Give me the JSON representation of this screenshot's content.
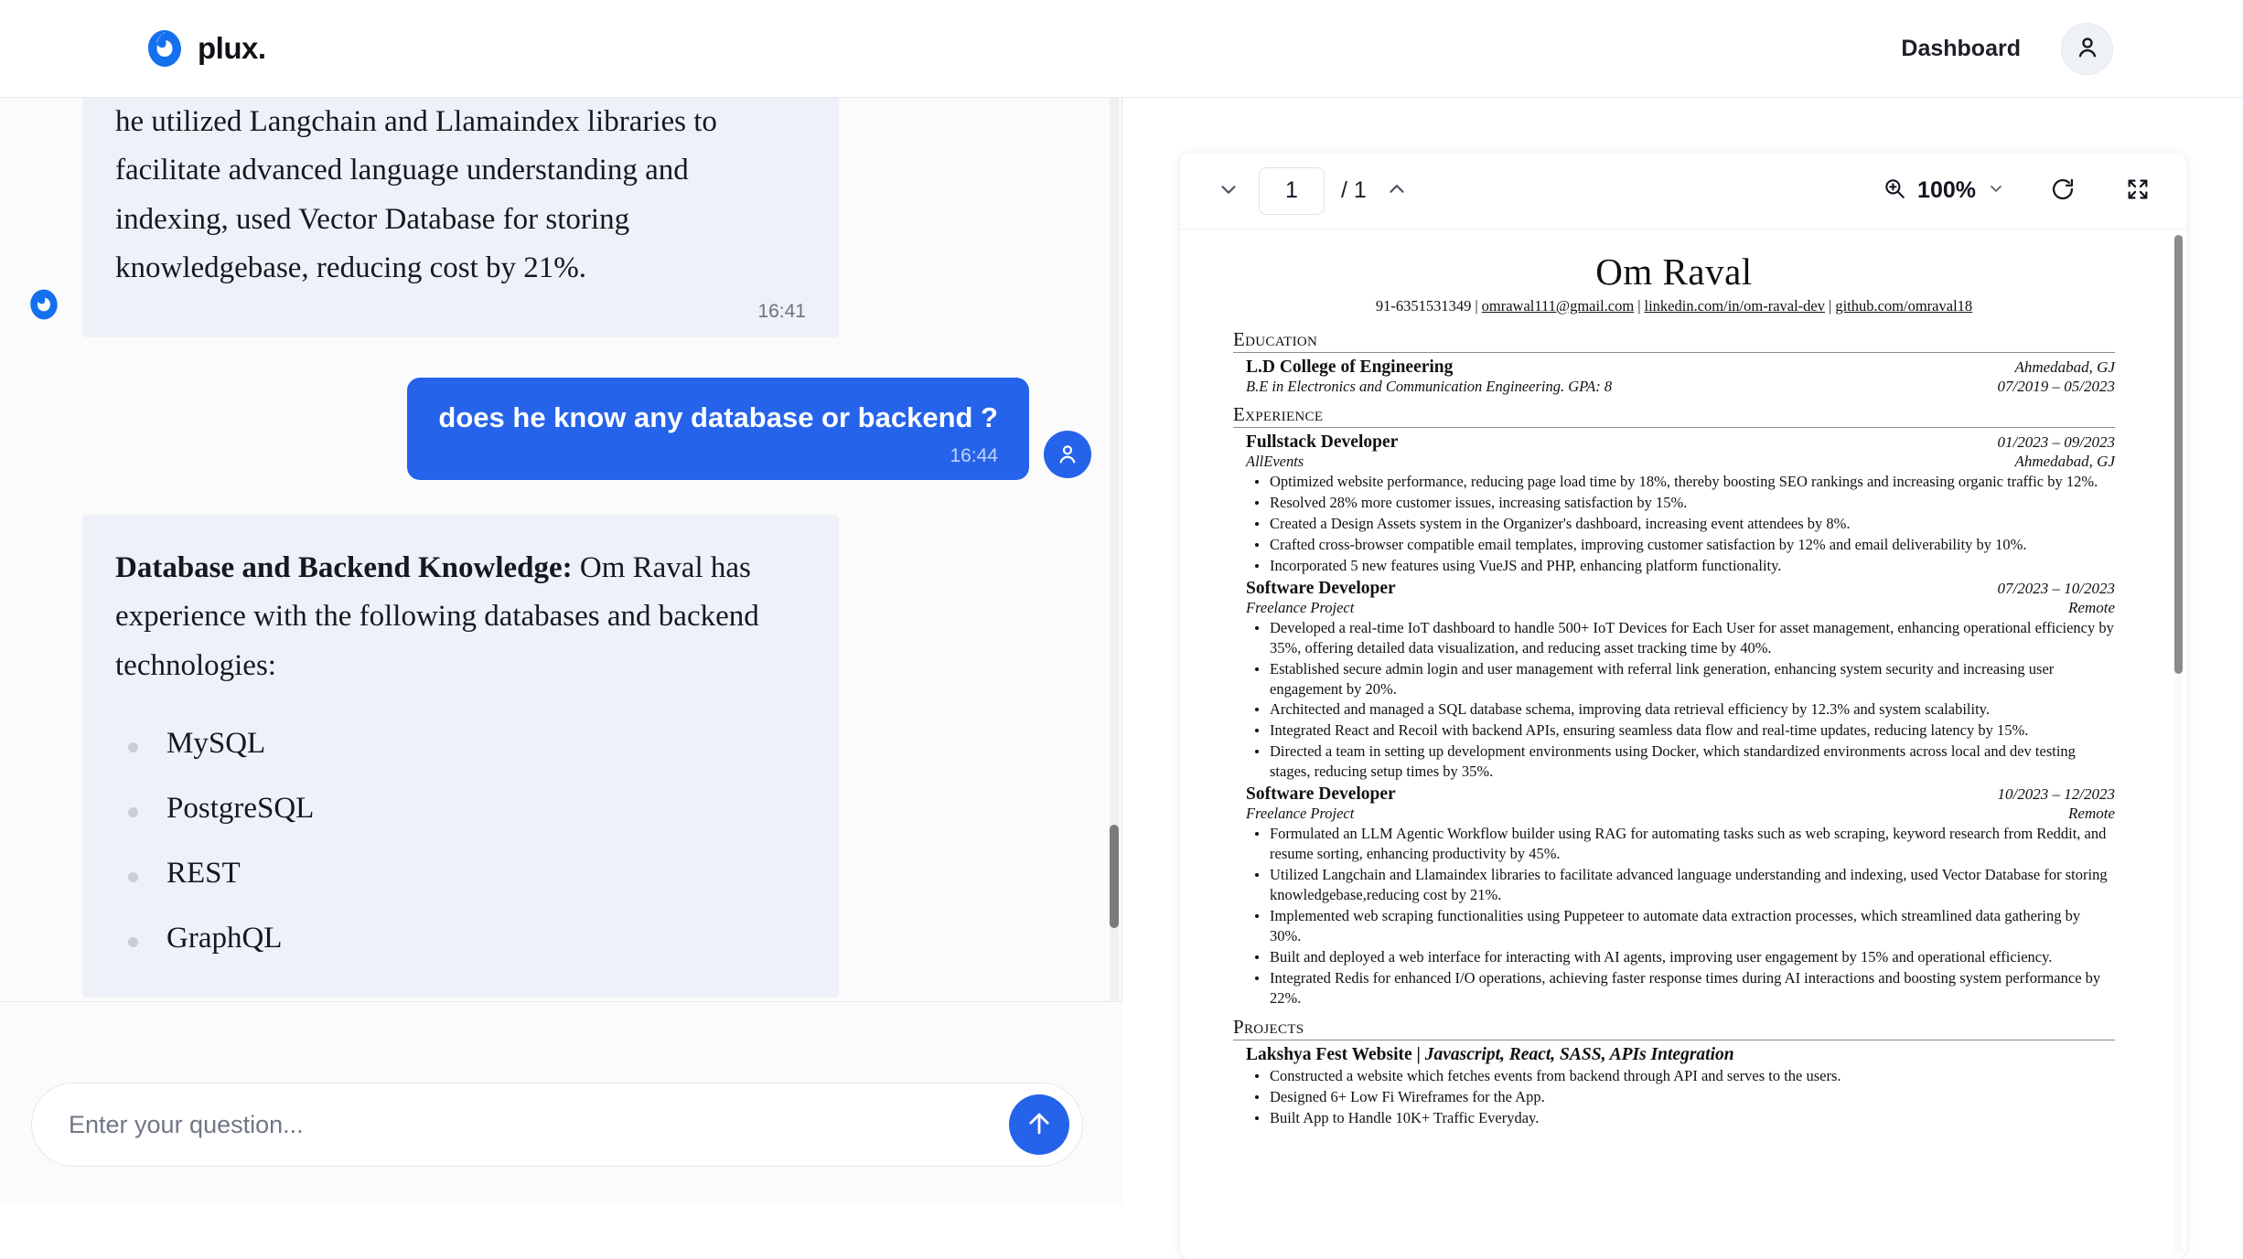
{
  "header": {
    "brand_name": "plux.",
    "logo_icon": "plux-droplet-logo",
    "dashboard_label": "Dashboard",
    "avatar_icon": "user-avatar-icon",
    "accent_color": "#2563eb"
  },
  "chat": {
    "messages": [
      {
        "role": "assistant",
        "text": "he utilized Langchain and Llamaindex libraries to facilitate advanced language understanding and indexing, used Vector Database for storing knowledgebase, reducing cost by 21%.",
        "time": "16:41"
      },
      {
        "role": "user",
        "text": "does he know any database or backend ?",
        "time": "16:44"
      }
    ],
    "answer": {
      "lead_bold": "Database and Backend Knowledge:",
      "lead_rest": " Om Raval has experience with the following databases and backend technologies:",
      "items": [
        "MySQL",
        "PostgreSQL",
        "REST",
        "GraphQL"
      ]
    },
    "composer": {
      "placeholder": "Enter your question...",
      "value": "",
      "send_icon": "arrow-up-icon"
    }
  },
  "pdf_viewer": {
    "page_current": "1",
    "page_total": "/ 1",
    "prev_icon": "chevron-down-icon",
    "next_icon": "chevron-up-icon",
    "zoom_icon": "zoom-in-icon",
    "zoom_level": "100%",
    "zoom_dropdown_icon": "chevron-down-icon",
    "rotate_icon": "rotate-refresh-icon",
    "fullscreen_icon": "fullscreen-expand-icon"
  },
  "resume": {
    "name": "Om Raval",
    "contact": {
      "phone": "91-6351531349",
      "email": "omrawal111@gmail.com",
      "linkedin": "linkedin.com/in/om-raval-dev",
      "github": "github.com/omraval18"
    },
    "sections": {
      "education_heading": "Education",
      "experience_heading": "Experience",
      "projects_heading": "Projects"
    },
    "education": [
      {
        "school": "L.D College of Engineering",
        "location": "Ahmedabad, GJ",
        "degree": "B.E in Electronics and Communication Engineering.  GPA: 8",
        "dates": "07/2019 – 05/2023"
      }
    ],
    "experience": [
      {
        "title": "Fullstack Developer",
        "dates": "01/2023 – 09/2023",
        "company": "AllEvents",
        "location": "Ahmedabad, GJ",
        "bullets": [
          "Optimized website performance, reducing page load time by 18%, thereby boosting SEO rankings and increasing organic traffic by 12%.",
          "Resolved 28% more customer issues, increasing satisfaction by 15%.",
          "Created a Design Assets system in the Organizer's dashboard, increasing event attendees by 8%.",
          "Crafted cross-browser compatible email templates, improving customer satisfaction by 12% and email deliverability by 10%.",
          "Incorporated 5 new features using VueJS and PHP, enhancing platform functionality."
        ]
      },
      {
        "title": "Software Developer",
        "dates": "07/2023 – 10/2023",
        "company": "Freelance Project",
        "location": "Remote",
        "bullets": [
          "Developed a real-time IoT dashboard to handle 500+ IoT Devices for Each User for asset management, enhancing operational efficiency by 35%, offering detailed data visualization, and reducing asset tracking time by 40%.",
          "Established secure admin login and user management with referral link generation, enhancing system security and increasing user engagement by 20%.",
          "Architected and managed a SQL database schema, improving data retrieval efficiency by 12.3% and system scalability.",
          "Integrated React and Recoil with backend APIs, ensuring seamless data flow and real-time updates, reducing latency by 15%.",
          "Directed a team in setting up development environments using Docker, which standardized environments across local and dev testing stages, reducing setup times by 35%."
        ]
      },
      {
        "title": "Software Developer",
        "dates": "10/2023 – 12/2023",
        "company": "Freelance Project",
        "location": "Remote",
        "bullets": [
          "Formulated an LLM Agentic Workflow builder using RAG for automating tasks such as web scraping, keyword research from Reddit, and resume sorting, enhancing productivity by 45%.",
          "Utilized Langchain and Llamaindex libraries to facilitate advanced language understanding and indexing, used Vector Database for storing knowledgebase,reducing cost by 21%.",
          "Implemented web scraping functionalities using Puppeteer to automate data extraction processes, which streamlined data gathering by 30%.",
          "Built and deployed a web interface for interacting with AI agents, improving user engagement by 15% and operational efficiency.",
          "Integrated Redis for enhanced I/O operations, achieving faster response times during AI interactions and boosting system performance by 22%."
        ]
      }
    ],
    "projects": [
      {
        "name": "Lakshya Fest Website",
        "stack": "Javascript, React, SASS, APIs Integration",
        "bullets": [
          "Constructed a website which fetches events from backend through API and serves to the users.",
          "Designed 6+ Low Fi Wireframes for the App.",
          "Built App to Handle 10K+ Traffic Everyday."
        ]
      }
    ]
  }
}
